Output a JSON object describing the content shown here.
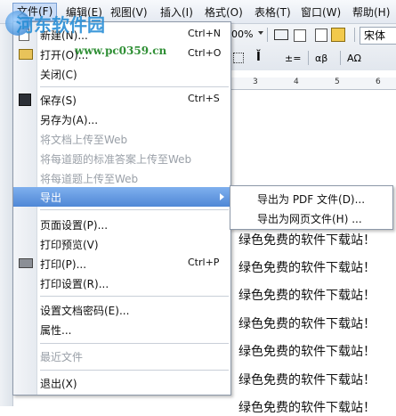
{
  "menubar": {
    "items": [
      {
        "label": "文件(F)"
      },
      {
        "label": "编辑(E)"
      },
      {
        "label": "视图(V)"
      },
      {
        "label": "插入(I)"
      },
      {
        "label": "格式(O)"
      },
      {
        "label": "表格(T)"
      },
      {
        "label": "窗口(W)"
      },
      {
        "label": "帮助(H)"
      }
    ]
  },
  "toolbar": {
    "zoom": "00%",
    "font": "宋体",
    "symbol_label": "±=",
    "greek_label": "αβ",
    "text_label": "AΩ"
  },
  "ruler": {
    "numbers": [
      "3",
      "4",
      "5",
      "6"
    ]
  },
  "file_menu": {
    "items": [
      {
        "label": "新建(N)...",
        "shortcut": "Ctrl+N"
      },
      {
        "label": "打开(O)...",
        "shortcut": "Ctrl+O"
      },
      {
        "label": "关闭(C)"
      },
      {
        "label": "保存(S)",
        "shortcut": "Ctrl+S"
      },
      {
        "label": "另存为(A)..."
      },
      {
        "label": "将文档上传至Web"
      },
      {
        "label": "将每道题的标准答案上传至Web"
      },
      {
        "label": "将每道题上传至Web"
      },
      {
        "label": "导出"
      },
      {
        "label": "页面设置(P)..."
      },
      {
        "label": "打印预览(V)"
      },
      {
        "label": "打印(P)...",
        "shortcut": "Ctrl+P"
      },
      {
        "label": "打印设置(R)..."
      },
      {
        "label": "设置文档密码(E)..."
      },
      {
        "label": "属性..."
      },
      {
        "label": "最近文件"
      },
      {
        "label": "退出(X)"
      }
    ]
  },
  "export_submenu": {
    "items": [
      {
        "label": "导出为 PDF 文件(D)..."
      },
      {
        "label": "导出为网页文件(H) ..."
      }
    ]
  },
  "document": {
    "lines": [
      "绿色免费的软件下载站！",
      "绿色免费的软件下载站！",
      "绿色免费的软件下载站！",
      "绿色免费的软件下载站！",
      "绿色免费的软件下载站！",
      "绿色免费的软件下载站！",
      "绿色免费的软件下载站！"
    ]
  },
  "watermark": {
    "title": "河东软件园",
    "url": "www.pc0359.cn"
  },
  "colors": {
    "highlight": "#4f87d6",
    "watermark": "#2a8fd6"
  }
}
